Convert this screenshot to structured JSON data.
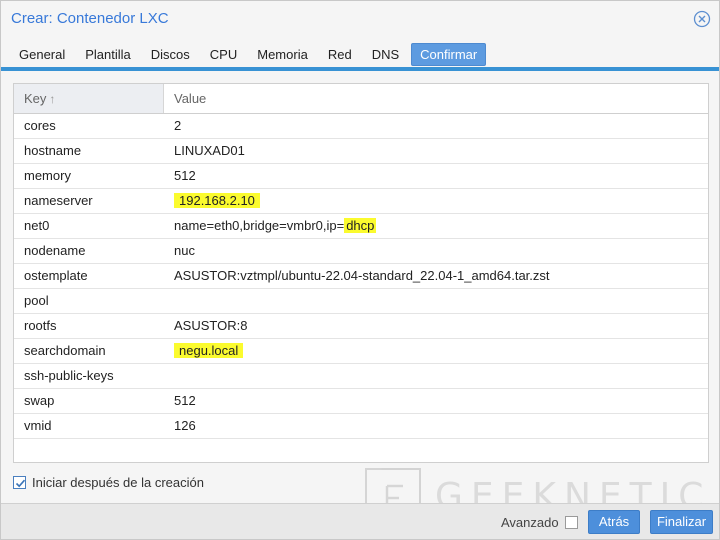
{
  "window": {
    "title": "Crear: Contenedor LXC"
  },
  "tabs": [
    {
      "label": "General",
      "active": false
    },
    {
      "label": "Plantilla",
      "active": false
    },
    {
      "label": "Discos",
      "active": false
    },
    {
      "label": "CPU",
      "active": false
    },
    {
      "label": "Memoria",
      "active": false
    },
    {
      "label": "Red",
      "active": false
    },
    {
      "label": "DNS",
      "active": false
    },
    {
      "label": "Confirmar",
      "active": true
    }
  ],
  "grid": {
    "headers": {
      "key": "Key",
      "value": "Value"
    },
    "rows": [
      {
        "key": "cores",
        "value": "2"
      },
      {
        "key": "hostname",
        "value": "LINUXAD01"
      },
      {
        "key": "memory",
        "value": "512"
      },
      {
        "key": "nameserver",
        "value": "192.168.2.10"
      },
      {
        "key": "net0",
        "value_prefix": "name=eth0,bridge=vmbr0,ip=",
        "value_highlight": "dhcp"
      },
      {
        "key": "nodename",
        "value": "nuc"
      },
      {
        "key": "ostemplate",
        "value": "ASUSTOR:vztmpl/ubuntu-22.04-standard_22.04-1_amd64.tar.zst"
      },
      {
        "key": "pool",
        "value": ""
      },
      {
        "key": "rootfs",
        "value": "ASUSTOR:8"
      },
      {
        "key": "searchdomain",
        "value": "negu.local"
      },
      {
        "key": "ssh-public-keys",
        "value": ""
      },
      {
        "key": "swap",
        "value": "512"
      },
      {
        "key": "vmid",
        "value": "126"
      }
    ]
  },
  "start_after_create": {
    "label": "Iniciar después de la creación",
    "checked": true
  },
  "footer": {
    "advanced_label": "Avanzado",
    "advanced_checked": false,
    "back_label": "Atrás",
    "finish_label": "Finalizar"
  },
  "watermark": {
    "text": "GEEKNETIC"
  },
  "colors": {
    "accent": "#3892d4",
    "button": "#4d8fdb",
    "highlight": "#fbfb2e",
    "title": "#3879d9"
  }
}
